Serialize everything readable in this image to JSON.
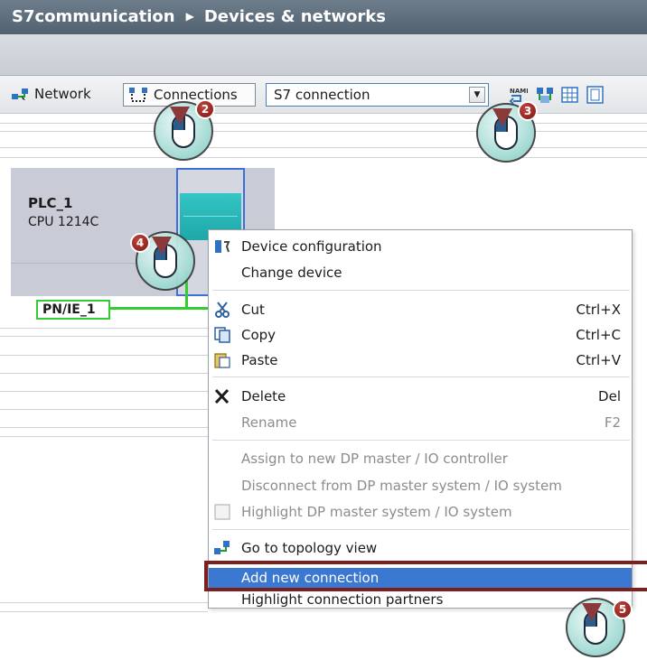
{
  "titlebar": {
    "project": "S7communication",
    "separator": "▶",
    "page": "Devices & networks"
  },
  "toolbar": {
    "network_label": "Network",
    "connections_label": "Connections",
    "connection_type_value": "S7 connection",
    "dropdown_arrow": "▼",
    "name_button_text": "NAME"
  },
  "device": {
    "name": "PLC_1",
    "type": "CPU 1214C"
  },
  "network": {
    "subnet_label": "PN/IE_1"
  },
  "menu": {
    "items": [
      {
        "label": "Device configuration",
        "shortcut": "",
        "icon": "device-config-icon",
        "enabled": true
      },
      {
        "label": "Change device",
        "shortcut": "",
        "icon": "",
        "enabled": true
      },
      {
        "label": "Cut",
        "shortcut": "Ctrl+X",
        "icon": "scissors-icon",
        "enabled": true
      },
      {
        "label": "Copy",
        "shortcut": "Ctrl+C",
        "icon": "copy-icon",
        "enabled": true
      },
      {
        "label": "Paste",
        "shortcut": "Ctrl+V",
        "icon": "paste-icon",
        "enabled": true
      },
      {
        "label": "Delete",
        "shortcut": "Del",
        "icon": "delete-x-icon",
        "enabled": true
      },
      {
        "label": "Rename",
        "shortcut": "F2",
        "icon": "",
        "enabled": false
      },
      {
        "label": "Assign to new DP master / IO controller",
        "shortcut": "",
        "icon": "",
        "enabled": false
      },
      {
        "label": "Disconnect from DP master system / IO system",
        "shortcut": "",
        "icon": "",
        "enabled": false
      },
      {
        "label": "Highlight DP master system / IO system",
        "shortcut": "",
        "icon": "checkbox-icon",
        "enabled": false
      },
      {
        "label": "Go to topology view",
        "shortcut": "",
        "icon": "topology-icon",
        "enabled": true
      },
      {
        "label": "Add new connection",
        "shortcut": "",
        "icon": "",
        "enabled": true,
        "highlighted": true
      },
      {
        "label": "Highlight connection partners",
        "shortcut": "",
        "icon": "",
        "enabled": true
      }
    ]
  },
  "steps": [
    "2",
    "3",
    "4",
    "5"
  ],
  "colors": {
    "accent": "#3b78d2",
    "highlight_frame": "#7b1f1f",
    "network_line": "#33cc33",
    "module_screen": "#1fa7a9",
    "step_badge": "#7c1512"
  }
}
